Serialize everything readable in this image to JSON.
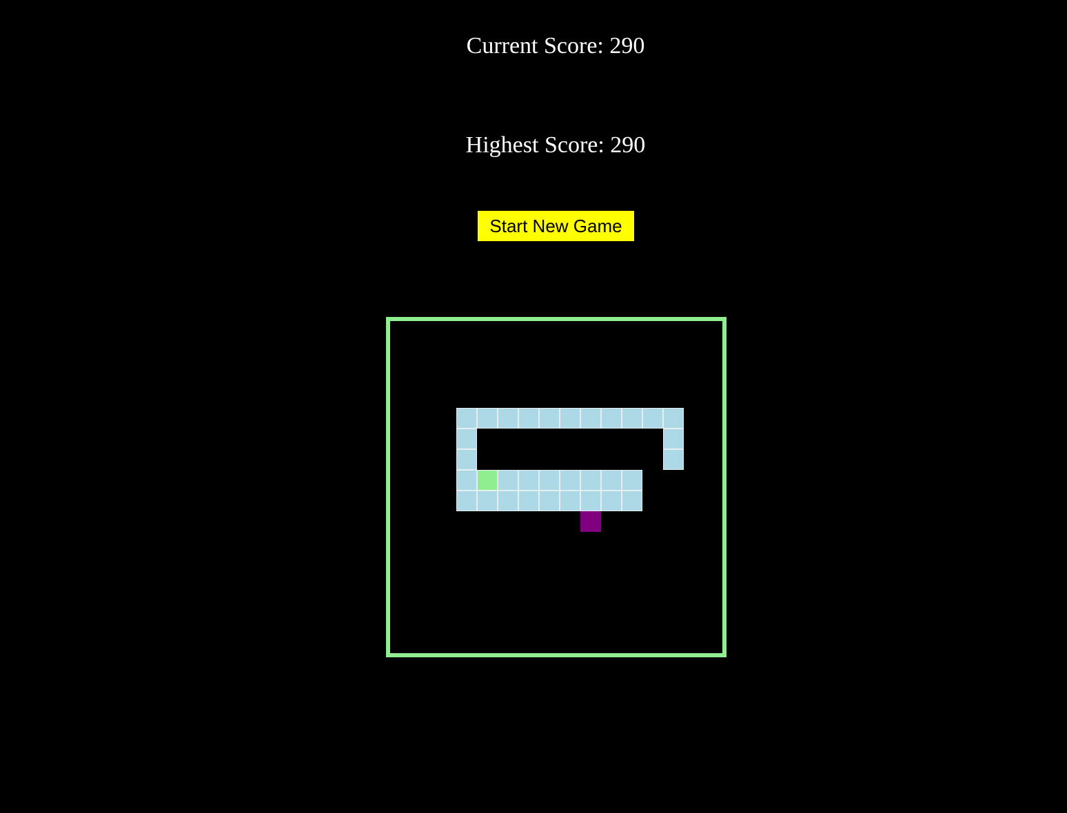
{
  "scores": {
    "current": "Current Score: 290",
    "highest": "Highest Score: 290"
  },
  "controls": {
    "start_label": "Start New Game"
  },
  "colors": {
    "background": "#000000",
    "score_text": "#ffffff",
    "button_bg": "#ffff00",
    "board_border": "#90ee90",
    "snake_body": "#add8e6",
    "snake_head": "#90ee90",
    "food": "#800080"
  },
  "board": {
    "snake_head": {
      "col": 4,
      "row": 7
    },
    "snake_body": [
      {
        "col": 3,
        "row": 4
      },
      {
        "col": 4,
        "row": 4
      },
      {
        "col": 5,
        "row": 4
      },
      {
        "col": 6,
        "row": 4
      },
      {
        "col": 7,
        "row": 4
      },
      {
        "col": 8,
        "row": 4
      },
      {
        "col": 9,
        "row": 4
      },
      {
        "col": 10,
        "row": 4
      },
      {
        "col": 11,
        "row": 4
      },
      {
        "col": 12,
        "row": 4
      },
      {
        "col": 13,
        "row": 4
      },
      {
        "col": 3,
        "row": 5
      },
      {
        "col": 13,
        "row": 5
      },
      {
        "col": 3,
        "row": 6
      },
      {
        "col": 13,
        "row": 6
      },
      {
        "col": 3,
        "row": 7
      },
      {
        "col": 5,
        "row": 7
      },
      {
        "col": 6,
        "row": 7
      },
      {
        "col": 7,
        "row": 7
      },
      {
        "col": 8,
        "row": 7
      },
      {
        "col": 9,
        "row": 7
      },
      {
        "col": 10,
        "row": 7
      },
      {
        "col": 11,
        "row": 7
      },
      {
        "col": 3,
        "row": 8
      },
      {
        "col": 4,
        "row": 8
      },
      {
        "col": 5,
        "row": 8
      },
      {
        "col": 6,
        "row": 8
      },
      {
        "col": 7,
        "row": 8
      },
      {
        "col": 8,
        "row": 8
      },
      {
        "col": 9,
        "row": 8
      },
      {
        "col": 10,
        "row": 8
      },
      {
        "col": 11,
        "row": 8
      }
    ],
    "food": {
      "col": 9,
      "row": 9
    }
  }
}
